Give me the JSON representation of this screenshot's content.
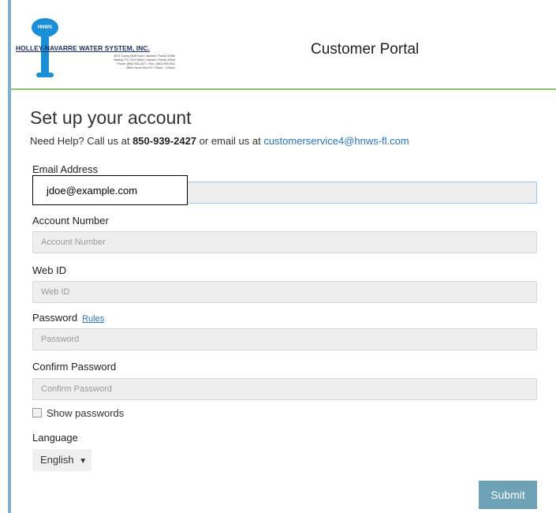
{
  "header": {
    "logo": {
      "drop_text": "HNWS",
      "company_name": "HOLLEY-NAVARRE WATER SYSTEM, INC.",
      "address_lines": [
        "8574 Turkey Bluff Road • Navarre, Florida 32566",
        "Mailing: P.O. BOX 8008 • Navarre, Florida 32566",
        "Phone: (850) 939-2427 • FAX: (850) 939-0541",
        "Office Hours Mon-Fri 7:30am – 4:00pm"
      ]
    },
    "portal_title": "Customer Portal"
  },
  "form": {
    "title": "Set up your account",
    "help": {
      "prefix": "Need Help? Call us at ",
      "phone": "850-939-2427",
      "middle": " or email us at ",
      "email": "customerservice4@hnws-fl.com"
    },
    "email": {
      "label": "Email Address",
      "value": "jdoe@example.com"
    },
    "account_number": {
      "label": "Account Number",
      "placeholder": "Account Number"
    },
    "web_id": {
      "label": "Web ID",
      "placeholder": "Web ID"
    },
    "password": {
      "label": "Password",
      "rules_link": "Rules",
      "placeholder": "Password"
    },
    "confirm_password": {
      "label": "Confirm Password",
      "placeholder": "Confirm Password"
    },
    "show_passwords_label": "Show passwords",
    "language": {
      "label": "Language",
      "selected": "English",
      "arrow": "▼"
    },
    "submit_label": "Submit"
  },
  "colors": {
    "accent_green": "#8dc26f",
    "link_blue": "#2a73b5",
    "submit_bg": "#6da2b6",
    "logo_blue": "#1a8fd6"
  }
}
